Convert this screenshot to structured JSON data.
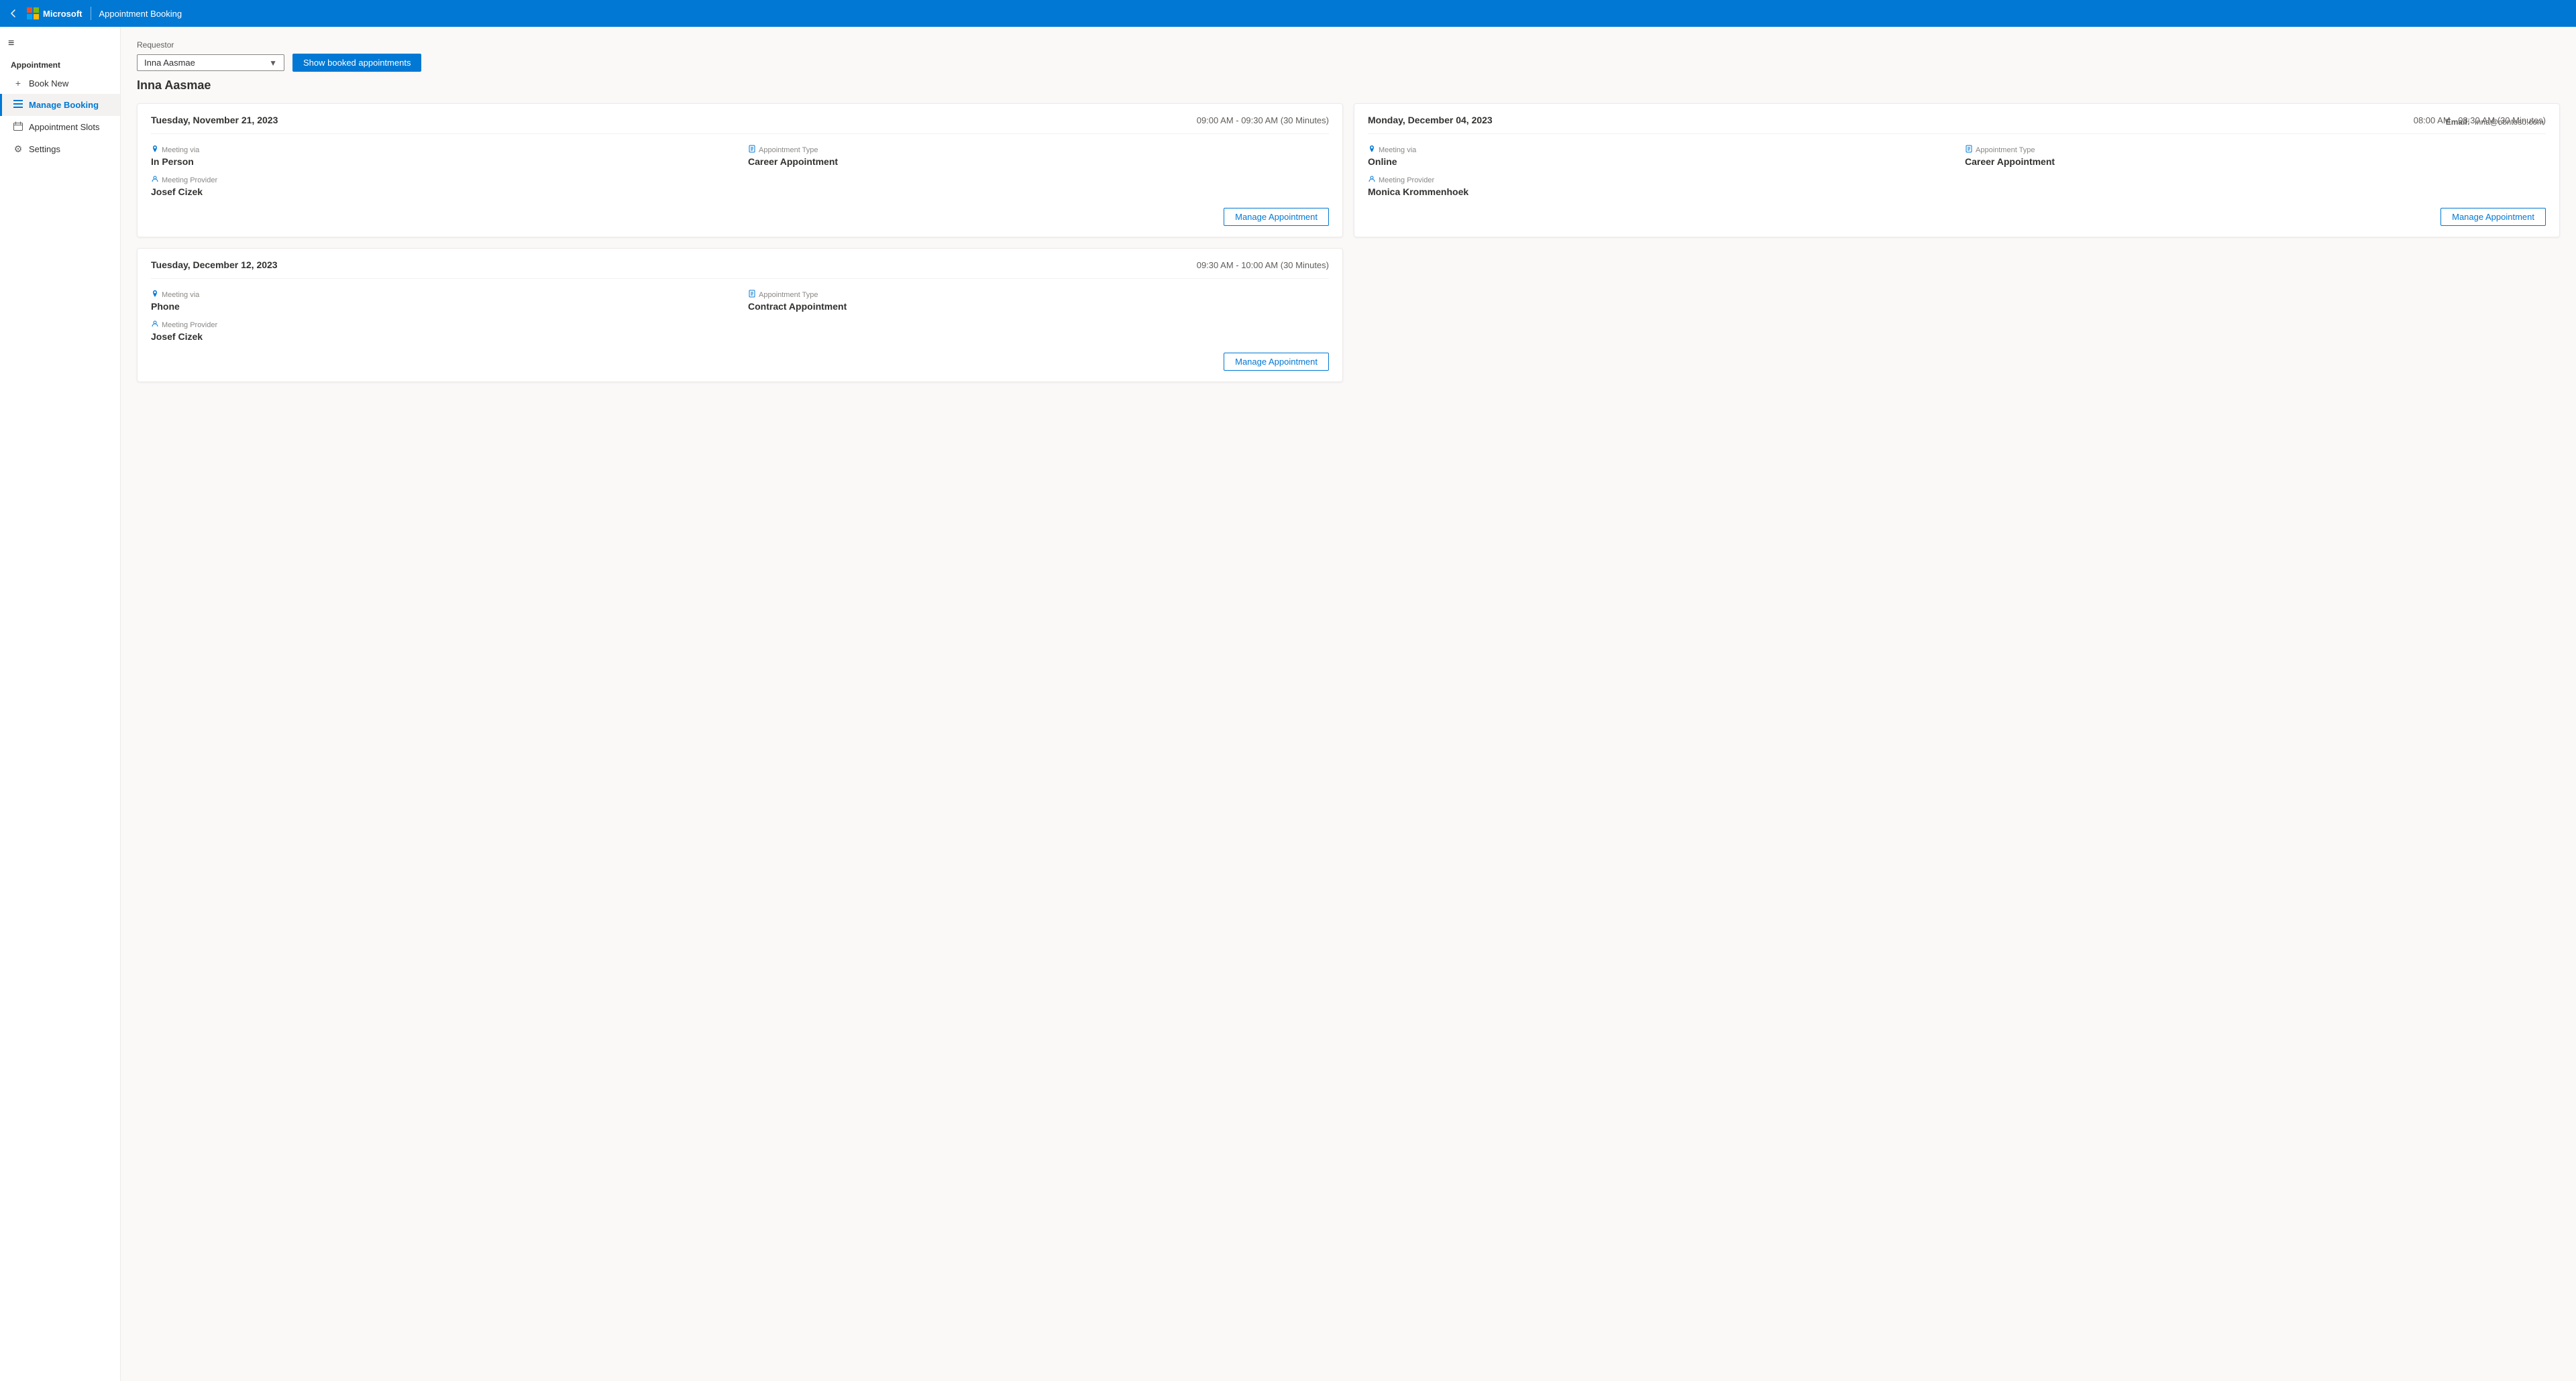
{
  "topbar": {
    "brand": "Microsoft",
    "title": "Appointment Booking",
    "back_label": "‹"
  },
  "sidebar": {
    "hamburger": "≡",
    "section_title": "Appointment",
    "items": [
      {
        "id": "book-new",
        "label": "Book New",
        "icon": "+",
        "active": false
      },
      {
        "id": "manage-booking",
        "label": "Manage Booking",
        "icon": "☰",
        "active": true
      },
      {
        "id": "appointment-slots",
        "label": "Appointment Slots",
        "icon": "▭",
        "active": false
      },
      {
        "id": "settings",
        "label": "Settings",
        "icon": "⚙",
        "active": false
      }
    ]
  },
  "main": {
    "requestor_label": "Requestor",
    "requestor_name": "Inna Aasmae",
    "requestor_email_label": "Email:",
    "requestor_email": "inna@contoso.com",
    "show_booked_btn": "Show booked appointments",
    "cards": [
      {
        "date": "Tuesday, November 21, 2023",
        "time": "09:00 AM - 09:30 AM (30 Minutes)",
        "meeting_via_label": "Meeting via",
        "meeting_via": "In Person",
        "appointment_type_label": "Appointment Type",
        "appointment_type": "Career Appointment",
        "meeting_provider_label": "Meeting Provider",
        "meeting_provider": "Josef Cizek",
        "manage_btn": "Manage Appointment"
      },
      {
        "date": "Monday, December 04, 2023",
        "time": "08:00 AM - 08:30 AM (30 Minutes)",
        "meeting_via_label": "Meeting via",
        "meeting_via": "Online",
        "appointment_type_label": "Appointment Type",
        "appointment_type": "Career Appointment",
        "meeting_provider_label": "Meeting Provider",
        "meeting_provider": "Monica Krommenhoek",
        "manage_btn": "Manage Appointment"
      },
      {
        "date": "Tuesday, December 12, 2023",
        "time": "09:30 AM - 10:00 AM (30 Minutes)",
        "meeting_via_label": "Meeting via",
        "meeting_via": "Phone",
        "appointment_type_label": "Appointment Type",
        "appointment_type": "Contract Appointment",
        "meeting_provider_label": "Meeting Provider",
        "meeting_provider": "Josef Cizek",
        "manage_btn": "Manage Appointment"
      }
    ]
  }
}
